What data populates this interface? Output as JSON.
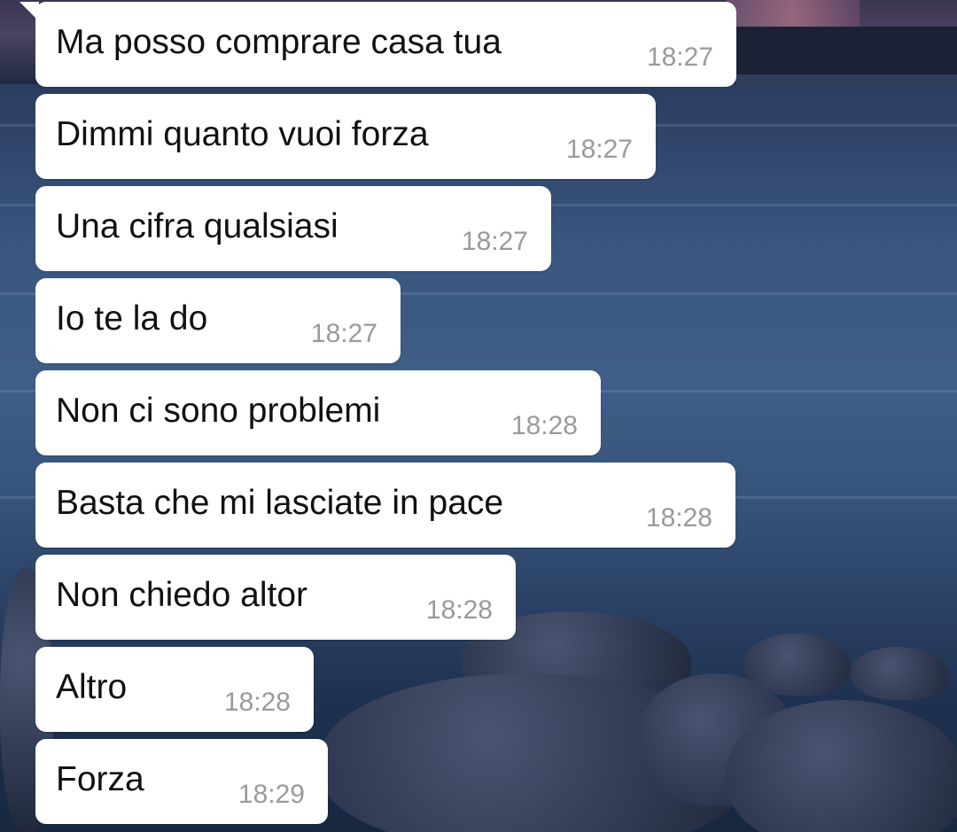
{
  "chat": {
    "messages": [
      {
        "text": "Ma posso comprare casa tua",
        "time": "18:27"
      },
      {
        "text": "Dimmi quanto vuoi forza",
        "time": "18:27"
      },
      {
        "text": "Una cifra qualsiasi",
        "time": "18:27"
      },
      {
        "text": "Io te la do",
        "time": "18:27"
      },
      {
        "text": "Non ci sono problemi",
        "time": "18:28"
      },
      {
        "text": "Basta che mi lasciate in pace",
        "time": "18:28"
      },
      {
        "text": "Non chiedo altor",
        "time": "18:28"
      },
      {
        "text": "Altro",
        "time": "18:28"
      },
      {
        "text": "Forza",
        "time": "18:29"
      }
    ]
  },
  "colors": {
    "bubble_bg": "#ffffff",
    "message_text": "#111111",
    "timestamp_text": "#9a9a9a"
  }
}
